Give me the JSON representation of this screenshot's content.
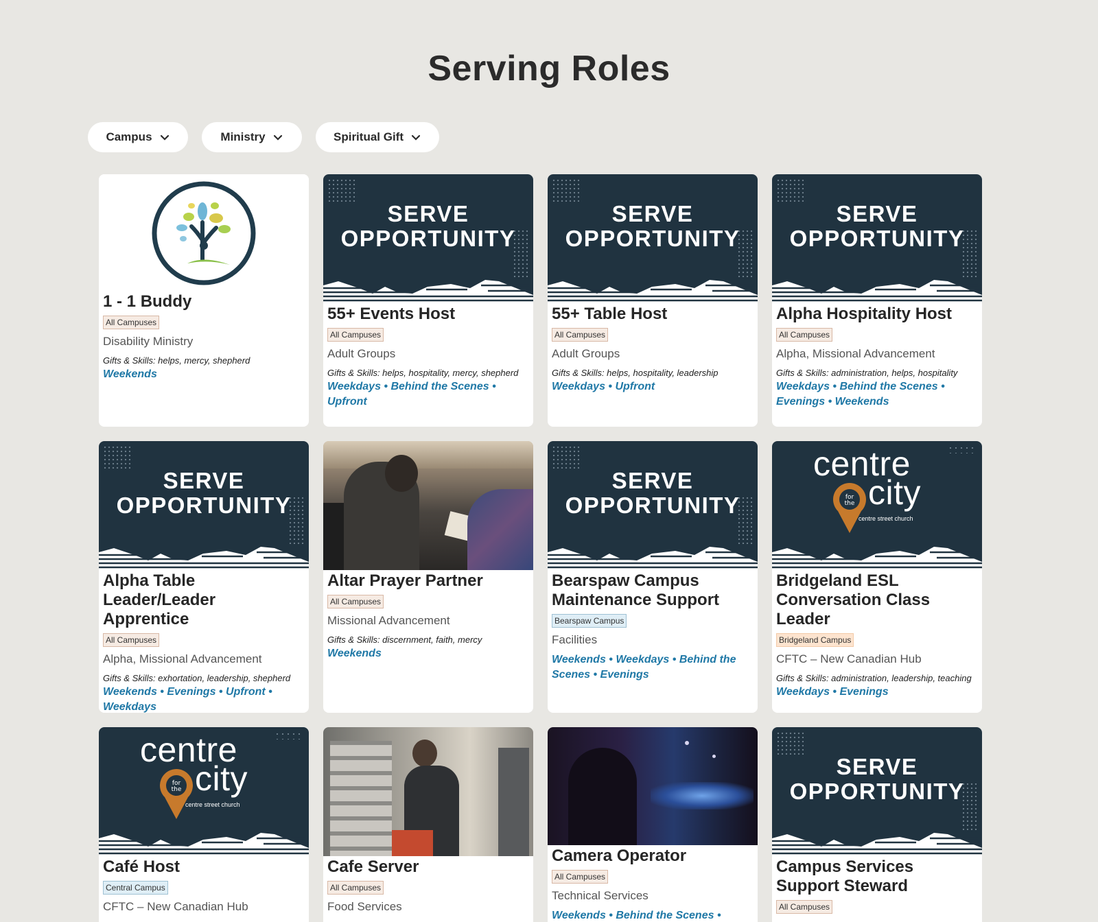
{
  "page": {
    "title": "Serving Roles"
  },
  "filters": [
    {
      "label": "Campus"
    },
    {
      "label": "Ministry"
    },
    {
      "label": "Spiritual Gift"
    }
  ],
  "banner_text": {
    "serve": "SERVE",
    "opportunity": "OPPORTUNITY",
    "centre": "centre",
    "city": "city",
    "for_the": "for the",
    "church": "centre street church"
  },
  "cards": [
    {
      "title": "1 - 1 Buddy",
      "campus": "All Campuses",
      "ministry": "Disability Ministry",
      "gifts": "Gifts & Skills: helps, mercy, shepherd",
      "times": "Weekends"
    },
    {
      "title": "55+ Events Host",
      "campus": "All Campuses",
      "ministry": "Adult Groups",
      "gifts": "Gifts & Skills: helps, hospitality, mercy, shepherd",
      "times": "Weekdays • Behind the Scenes • Upfront"
    },
    {
      "title": "55+ Table Host",
      "campus": "All Campuses",
      "ministry": "Adult Groups",
      "gifts": "Gifts & Skills: helps, hospitality, leadership",
      "times": "Weekdays • Upfront"
    },
    {
      "title": "Alpha Hospitality Host",
      "campus": "All Campuses",
      "ministry": "Alpha, Missional Advancement",
      "gifts": "Gifts & Skills: administration, helps, hospitality",
      "times": "Weekdays • Behind the Scenes • Evenings • Weekends"
    },
    {
      "title": "Alpha Table Leader/Leader Apprentice",
      "campus": "All Campuses",
      "ministry": "Alpha, Missional Advancement",
      "gifts": "Gifts & Skills: exhortation, leadership, shepherd",
      "times": "Weekends • Evenings • Upfront • Weekdays"
    },
    {
      "title": "Altar Prayer Partner",
      "campus": "All Campuses",
      "ministry": "Missional Advancement",
      "gifts": "Gifts & Skills: discernment, faith, mercy",
      "times": "Weekends"
    },
    {
      "title": "Bearspaw Campus Maintenance Support",
      "campus": "Bearspaw Campus",
      "ministry": "Facilities",
      "gifts": "",
      "times": "Weekends • Weekdays • Behind the Scenes • Evenings"
    },
    {
      "title": "Bridgeland ESL Conversation Class Leader",
      "campus": "Bridgeland Campus",
      "ministry": "CFTC – New Canadian Hub",
      "gifts": "Gifts & Skills: administration, leadership, teaching",
      "times": "Weekdays • Evenings"
    },
    {
      "title": "Café Host",
      "campus": "Central Campus",
      "ministry": "CFTC – New Canadian Hub",
      "gifts": "",
      "times": ""
    },
    {
      "title": "Cafe Server",
      "campus": "All Campuses",
      "ministry": "Food Services",
      "gifts": "",
      "times": ""
    },
    {
      "title": "Camera Operator",
      "campus": "All Campuses",
      "ministry": "Technical Services",
      "gifts": "",
      "times": "Weekends • Behind the Scenes •"
    },
    {
      "title": "Campus Services Support Steward",
      "campus": "All Campuses",
      "ministry": "",
      "gifts": "",
      "times": ""
    }
  ],
  "colors": {
    "navy": "#203340",
    "accent_blue": "#1f78a6",
    "pin_orange": "#c77a2c",
    "background": "#e8e7e3"
  }
}
